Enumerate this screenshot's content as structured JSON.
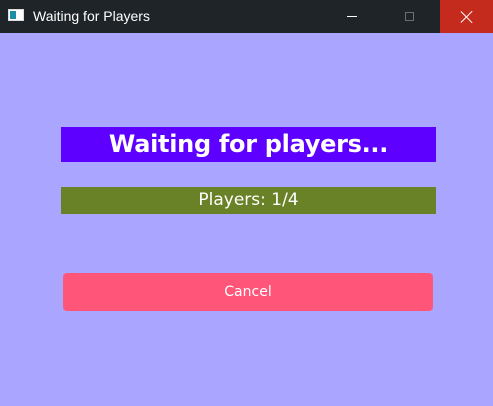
{
  "window": {
    "title": "Waiting for Players",
    "background": "#aaa6ff",
    "titlebar_color": "#1f2428",
    "close_button_color": "#c42b1c",
    "icon": "window-app-icon"
  },
  "controls": {
    "minimize_icon": "minimize-icon",
    "maximize_icon": "maximize-icon",
    "close_icon": "close-icon"
  },
  "main": {
    "heading": "Waiting for players...",
    "heading_bg": "#5e00ff",
    "players_status": "Players: 1/4",
    "players_bg": "#6a8227",
    "cancel_label": "Cancel",
    "cancel_bg": "#ff5579"
  }
}
